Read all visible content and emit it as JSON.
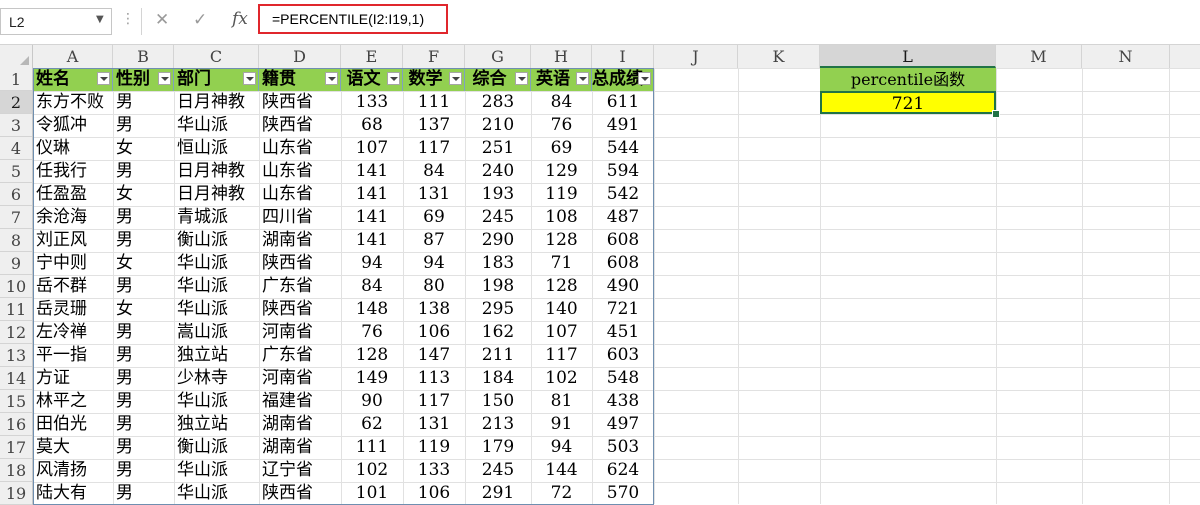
{
  "toolbar": {
    "name_box": "L2",
    "dropdown_arrow": "▼",
    "more": "⋮",
    "cancel_icon": "✕",
    "confirm_icon": "✓",
    "fx": "fx",
    "formula": "=PERCENTILE(I2:I19,1)"
  },
  "columns": [
    "A",
    "B",
    "C",
    "D",
    "E",
    "F",
    "G",
    "H",
    "I",
    "J",
    "K",
    "L",
    "M",
    "N"
  ],
  "rows": [
    "1",
    "2",
    "3",
    "4",
    "5",
    "6",
    "7",
    "8",
    "9",
    "10",
    "11",
    "12",
    "13",
    "14",
    "15",
    "16",
    "17",
    "18",
    "19"
  ],
  "table": {
    "headers": [
      "姓名",
      "性别",
      "部门",
      "籍贯",
      "语文",
      "数学",
      "综合",
      "英语",
      "总成绩"
    ],
    "rows": [
      [
        "东方不败",
        "男",
        "日月神教",
        "陕西省",
        "133",
        "111",
        "283",
        "84",
        "611"
      ],
      [
        "令狐冲",
        "男",
        "华山派",
        "陕西省",
        "68",
        "137",
        "210",
        "76",
        "491"
      ],
      [
        "仪琳",
        "女",
        "恒山派",
        "山东省",
        "107",
        "117",
        "251",
        "69",
        "544"
      ],
      [
        "任我行",
        "男",
        "日月神教",
        "山东省",
        "141",
        "84",
        "240",
        "129",
        "594"
      ],
      [
        "任盈盈",
        "女",
        "日月神教",
        "山东省",
        "141",
        "131",
        "193",
        "119",
        "542"
      ],
      [
        "余沧海",
        "男",
        "青城派",
        "四川省",
        "141",
        "69",
        "245",
        "108",
        "487"
      ],
      [
        "刘正风",
        "男",
        "衡山派",
        "湖南省",
        "141",
        "87",
        "290",
        "128",
        "608"
      ],
      [
        "宁中则",
        "女",
        "华山派",
        "陕西省",
        "94",
        "94",
        "183",
        "71",
        "608"
      ],
      [
        "岳不群",
        "男",
        "华山派",
        "广东省",
        "84",
        "80",
        "198",
        "128",
        "490"
      ],
      [
        "岳灵珊",
        "女",
        "华山派",
        "陕西省",
        "148",
        "138",
        "295",
        "140",
        "721"
      ],
      [
        "左冷禅",
        "男",
        "嵩山派",
        "河南省",
        "76",
        "106",
        "162",
        "107",
        "451"
      ],
      [
        "平一指",
        "男",
        "独立站",
        "广东省",
        "128",
        "147",
        "211",
        "117",
        "603"
      ],
      [
        "方证",
        "男",
        "少林寺",
        "河南省",
        "149",
        "113",
        "184",
        "102",
        "548"
      ],
      [
        "林平之",
        "男",
        "华山派",
        "福建省",
        "90",
        "117",
        "150",
        "81",
        "438"
      ],
      [
        "田伯光",
        "男",
        "独立站",
        "湖南省",
        "62",
        "131",
        "213",
        "91",
        "497"
      ],
      [
        "莫大",
        "男",
        "衡山派",
        "湖南省",
        "111",
        "119",
        "179",
        "94",
        "503"
      ],
      [
        "风清扬",
        "男",
        "华山派",
        "辽宁省",
        "102",
        "133",
        "245",
        "144",
        "624"
      ],
      [
        "陆大有",
        "男",
        "华山派",
        "陕西省",
        "101",
        "106",
        "291",
        "72",
        "570"
      ]
    ]
  },
  "side": {
    "label": "percentile函数",
    "value": "721"
  },
  "colors": {
    "header_green": "#92d050",
    "result_yellow": "#ffff00",
    "formula_outline": "#e0262c",
    "selection": "#217346"
  }
}
